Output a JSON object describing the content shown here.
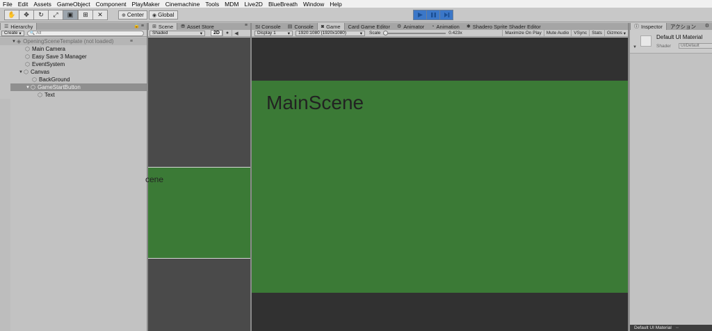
{
  "menu": [
    "File",
    "Edit",
    "Assets",
    "GameObject",
    "Component",
    "PlayMaker",
    "Cinemachine",
    "Tools",
    "MDM",
    "Live2D",
    "BlueBreath",
    "Window",
    "Help"
  ],
  "toolbar": {
    "tools": [
      {
        "name": "hand-tool",
        "glyph": "✋"
      },
      {
        "name": "move-tool",
        "glyph": "✥"
      },
      {
        "name": "rotate-tool",
        "glyph": "↻"
      },
      {
        "name": "scale-tool",
        "glyph": "⤢"
      },
      {
        "name": "rect-tool",
        "glyph": "▣"
      },
      {
        "name": "transform-tool",
        "glyph": "⊞"
      },
      {
        "name": "custom-tool",
        "glyph": "✕"
      }
    ],
    "pivot_label": "Center",
    "space_label": "Global",
    "play_active_color": "#3b77c8"
  },
  "hierarchy": {
    "tab_label": "Hierarchy",
    "create_label": "Create",
    "search_placeholder": "All",
    "scene_label": "OpeningSceneTemplate (not loaded)",
    "items": [
      {
        "label": "Main Camera"
      },
      {
        "label": "Easy Save 3 Manager"
      },
      {
        "label": "EventSystem"
      },
      {
        "label": "Canvas"
      },
      {
        "label": "BackGround"
      },
      {
        "label": "GameStartButton"
      },
      {
        "label": "Text"
      }
    ]
  },
  "scene": {
    "tabs": [
      "Scene",
      "Asset Store"
    ],
    "shading": "Shaded",
    "mode_2d": "2D",
    "scene_text": "cene"
  },
  "game": {
    "tabs": [
      "SI Console",
      "Console",
      "Game",
      "Card Game Editor",
      "Animator",
      "Animation",
      "Shadero Sprite Shader Editor"
    ],
    "display": "Display 1",
    "resolution": "1920:1080 (1920x1080)",
    "scale_label": "Scale",
    "scale_value": "0.423x",
    "buttons": [
      "Maximize On Play",
      "Mute Audio",
      "VSync",
      "Stats",
      "Gizmos"
    ],
    "title_text": "MainScene",
    "green_color": "#3b7a36"
  },
  "inspector": {
    "tabs": [
      "Inspector",
      "アクション"
    ],
    "material_name": "Default UI Material",
    "shader_label": "Shader",
    "shader_value": "UI/Default",
    "bottom_label": "Default UI Material"
  }
}
